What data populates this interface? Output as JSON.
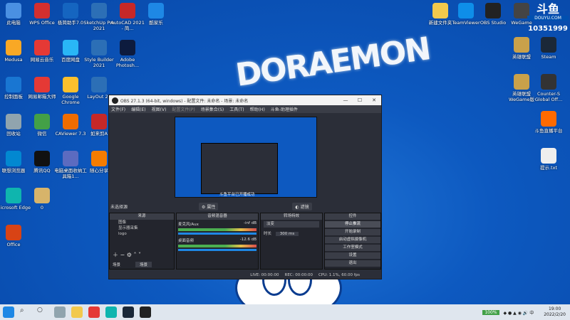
{
  "desktop": {
    "icons_left": [
      {
        "label": "此电脑",
        "color": "#4a90e2"
      },
      {
        "label": "WPS Office",
        "color": "#d32f2f"
      },
      {
        "label": "极简助手7.0",
        "color": "#1565c0"
      },
      {
        "label": "SketchUp Pro 2021",
        "color": "#2c6fb6"
      },
      {
        "label": "AutoCAD 2021 - 简...",
        "color": "#c62828"
      },
      {
        "label": "酷家乐",
        "color": "#1e88e5"
      },
      {
        "label": "Medusa",
        "color": "#f9a825"
      },
      {
        "label": "网易云音乐",
        "color": "#e53935"
      },
      {
        "label": "百度网盘",
        "color": "#29b6f6"
      },
      {
        "label": "Style Builder 2021",
        "color": "#2c6fb6"
      },
      {
        "label": "Adobe Photosh...",
        "color": "#0d1b3e"
      },
      {
        "label": "控制面板",
        "color": "#1976d2"
      },
      {
        "label": "网易邮箱大师",
        "color": "#e53935"
      },
      {
        "label": "Google Chrome",
        "color": "#fbc02d"
      },
      {
        "label": "LayOut 20",
        "color": "#2c6fb6"
      },
      {
        "label": "回收站",
        "color": "#90a4ae"
      },
      {
        "label": "微信",
        "color": "#43a047"
      },
      {
        "label": "CAViewer 7.3",
        "color": "#ef6c00"
      },
      {
        "label": "如来剪A",
        "color": "#c62828"
      },
      {
        "label": "联想浏览器",
        "color": "#0288d1"
      },
      {
        "label": "腾讯QQ",
        "color": "#111111"
      },
      {
        "label": "电脑桌面收纳工具箱1...",
        "color": "#5c6bc0"
      },
      {
        "label": "随心分享",
        "color": "#f57c00"
      },
      {
        "label": "Microsoft Edge",
        "color": "#0fb5ae"
      },
      {
        "label": "0",
        "color": "#d7b46a"
      },
      {
        "label": "Office",
        "color": "#d84315"
      }
    ],
    "icons_right": [
      {
        "label": "新建文件夹",
        "color": "#f2c94c"
      },
      {
        "label": "TeamViewer",
        "color": "#0e8ee9"
      },
      {
        "label": "OBS Studio",
        "color": "#222222"
      },
      {
        "label": "WeGame",
        "color": "#444444"
      },
      {
        "label": "英雄联盟",
        "color": "#c9a14a"
      },
      {
        "label": "Steam",
        "color": "#1b2838"
      },
      {
        "label": "英雄联盟WeGame版",
        "color": "#c9a14a"
      },
      {
        "label": "Counter-S Global Off...",
        "color": "#333333"
      },
      {
        "label": "斗鱼直播平台",
        "color": "#ff6a00"
      },
      {
        "label": "提示.txt",
        "color": "#eeeeee"
      }
    ],
    "douyu": {
      "brand": "斗鱼",
      "site": "DOUYU.COM",
      "room": "10351999"
    }
  },
  "obs": {
    "title": "OBS 27.1.3 (64-bit, windows) - 配置文件: 未命名 - 场景: 未命名",
    "menu": [
      "文件(F)",
      "编辑(E)",
      "视图(V)",
      "配置文件(P)",
      "场景集合(S)",
      "工具(T)",
      "帮助(H)",
      "斗鱼-助理插件"
    ],
    "preview_caption": "斗鱼平台已开播成功",
    "no_source": "未选择源",
    "toolbar": {
      "properties": "属性",
      "filters": "滤镜"
    },
    "docks": {
      "sources": "来源",
      "mixer": "音频混音器",
      "transitions": "转场特效",
      "controls": "控件",
      "scenes": "场景",
      "scene_item": "场景"
    },
    "sources": [
      "图像",
      "显示器采集",
      "logo"
    ],
    "mixer": [
      {
        "name": "麦克风/Aux",
        "db": "-inf dB"
      },
      {
        "name": "桌面音频",
        "db": "-12.6 dB"
      }
    ],
    "transition": {
      "type": "淡变",
      "duration_label": "时长",
      "duration": "300 ms"
    },
    "controls": [
      "停止推流",
      "开始录制",
      "启动虚拟摄像机",
      "工作室模式",
      "设置",
      "退出"
    ],
    "status": {
      "live": "LIVE: 00:00:00",
      "rec": "REC: 00:00:00",
      "cpu": "CPU: 1.1%, 60.00 fps"
    }
  },
  "taskbar": {
    "time": "19:00",
    "date": "2022/2/20",
    "battery": "100%"
  }
}
